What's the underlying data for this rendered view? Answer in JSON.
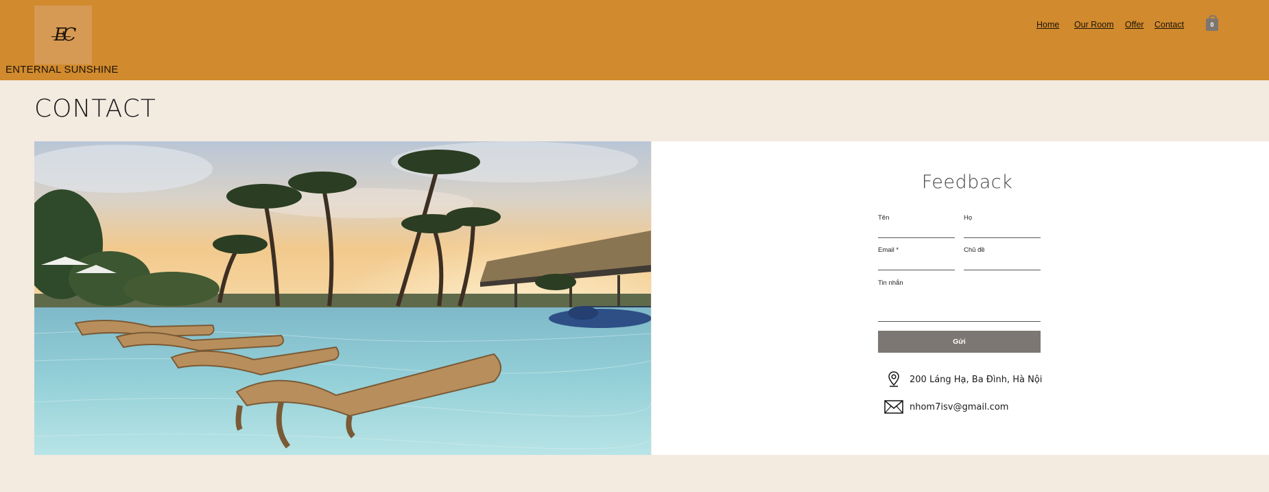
{
  "brand": {
    "logo_text": "EC",
    "name": "ENTERNAL SUNSHINE"
  },
  "nav": {
    "items": [
      {
        "label": "Home"
      },
      {
        "label": "Our Room"
      },
      {
        "label": "Offer"
      },
      {
        "label": "Contact"
      }
    ],
    "cart_count": "0"
  },
  "page": {
    "title": "CONTACT"
  },
  "form": {
    "title": "Feedback",
    "first_name_label": "Tên",
    "last_name_label": "Họ",
    "email_label": "Email *",
    "subject_label": "Chủ đề",
    "message_label": "Tin nhắn",
    "submit_label": "Gửi"
  },
  "contact": {
    "address": "200 Láng Hạ, Ba Đình, Hà Nội",
    "email": "nhom7isv@gmail.com"
  },
  "colors": {
    "header": "#d18a2d",
    "background": "#f3eae0",
    "button": "#7c7772"
  },
  "icons": [
    "location-pin-icon",
    "envelope-icon",
    "shopping-bag-icon"
  ]
}
